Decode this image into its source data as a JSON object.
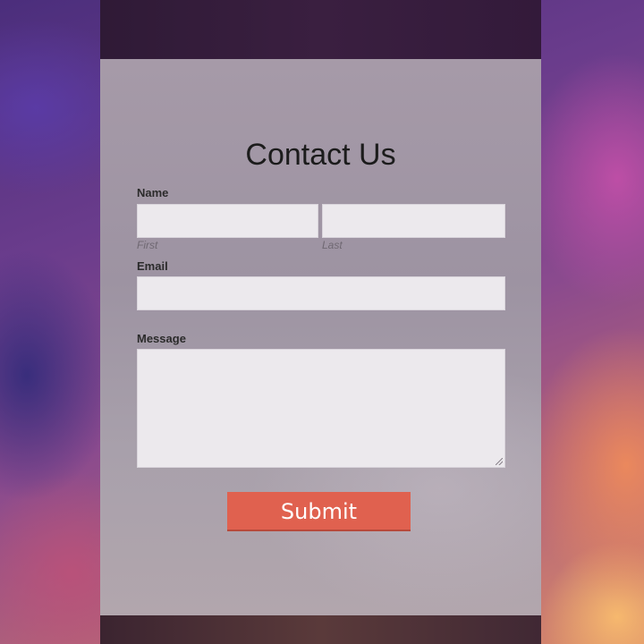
{
  "form": {
    "title": "Contact Us",
    "name_label": "Name",
    "first_sublabel": "First",
    "last_sublabel": "Last",
    "first_value": "",
    "last_value": "",
    "email_label": "Email",
    "email_value": "",
    "message_label": "Message",
    "message_value": "",
    "submit_label": "Submit"
  },
  "colors": {
    "submit_button": "#e0614f",
    "field_background": "#ece9ed"
  }
}
